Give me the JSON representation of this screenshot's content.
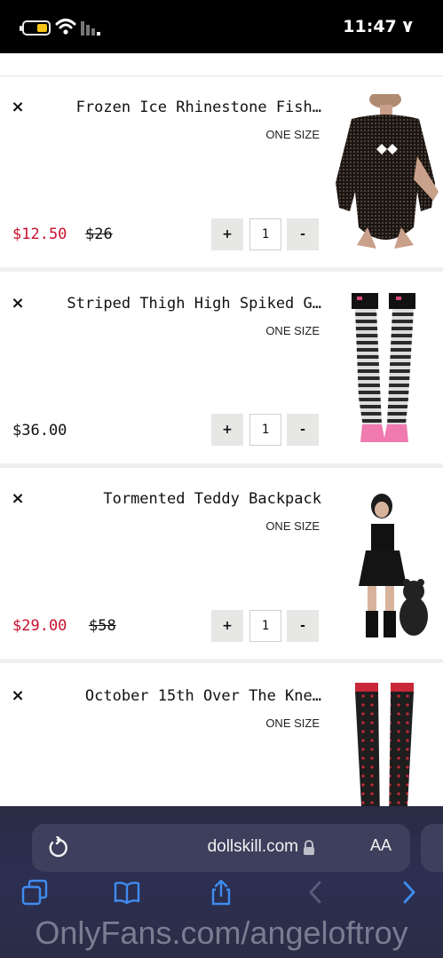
{
  "status_bar": {
    "time": "11:47 ٧",
    "battery_icon": "battery-icon",
    "wifi_icon": "wifi-icon",
    "signal_icon": "cellular-signal-icon"
  },
  "cart": {
    "items": [
      {
        "title": "Frozen Ice Rhinestone Fish…",
        "size": "ONE SIZE",
        "original_price": "$26",
        "sale_price": "$12.50",
        "quantity": "1",
        "minus_label": "-",
        "plus_label": "+",
        "remove_label": "×"
      },
      {
        "title": "Striped Thigh High Spiked G…",
        "size": "ONE SIZE",
        "price": "$36.00",
        "quantity": "1",
        "minus_label": "-",
        "plus_label": "+",
        "remove_label": "×"
      },
      {
        "title": "Tormented Teddy Backpack",
        "size": "ONE SIZE",
        "original_price": "$58",
        "sale_price": "$29.00",
        "quantity": "1",
        "minus_label": "-",
        "plus_label": "+",
        "remove_label": "×"
      },
      {
        "title": "October 15th Over The Kne…",
        "size": "ONE SIZE",
        "remove_label": "×"
      }
    ]
  },
  "browser": {
    "url": "dollskill.com",
    "text_size_label": "AA",
    "reload_icon": "reload-icon",
    "lock_icon": "lock-icon",
    "toolbar": [
      "back-icon",
      "forward-icon",
      "share-icon",
      "bookmarks-icon",
      "tabs-icon"
    ]
  },
  "watermark": "OnlyFans.com/angeloftroy",
  "colors": {
    "sale_red": "#c8102e",
    "status_bar_bg": "#000000",
    "browser_bg": "#2c2f52",
    "accent_blue": "#3f8cf0",
    "battery_yellow": "#f5c518"
  }
}
